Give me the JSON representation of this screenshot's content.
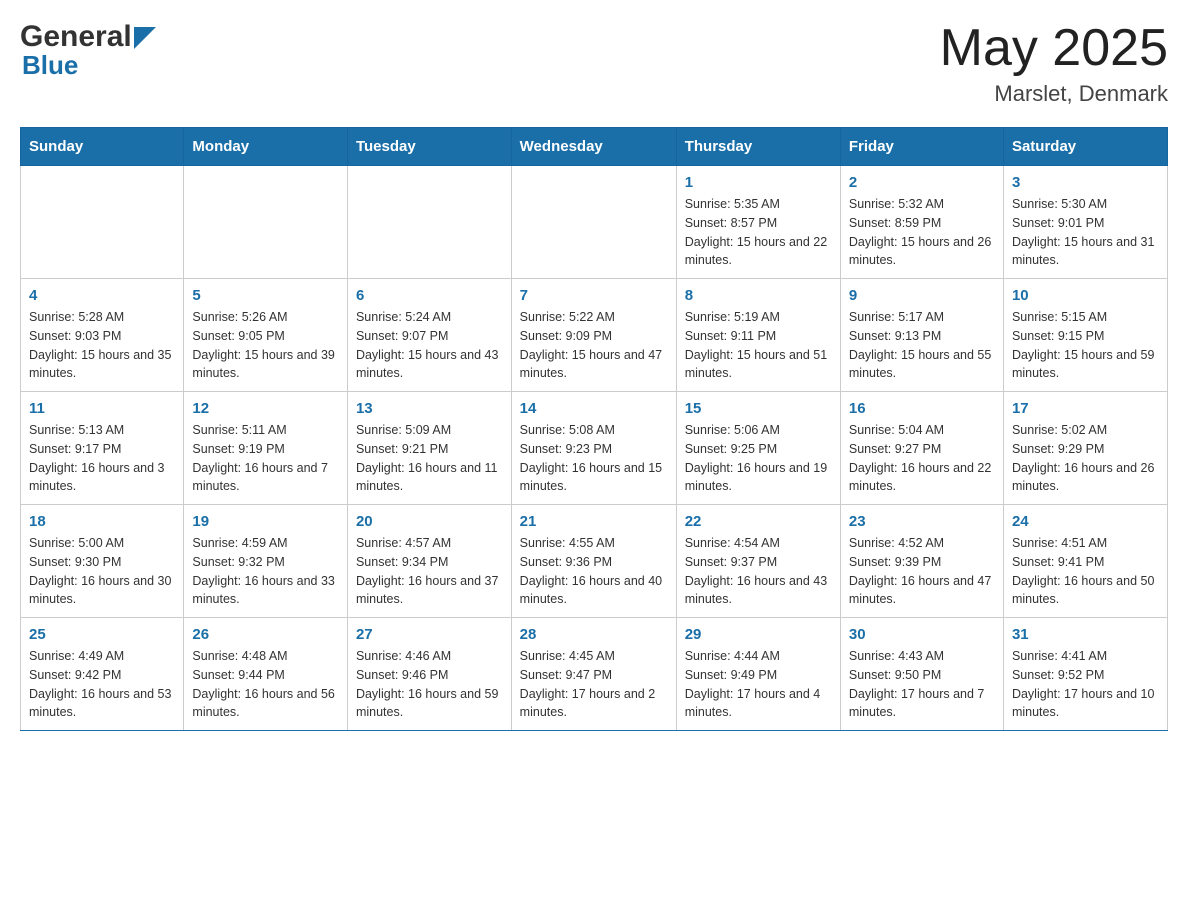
{
  "header": {
    "logo_general": "General",
    "logo_blue": "Blue",
    "month_year": "May 2025",
    "location": "Marslet, Denmark"
  },
  "weekdays": [
    "Sunday",
    "Monday",
    "Tuesday",
    "Wednesday",
    "Thursday",
    "Friday",
    "Saturday"
  ],
  "weeks": [
    [
      {
        "day": "",
        "info": ""
      },
      {
        "day": "",
        "info": ""
      },
      {
        "day": "",
        "info": ""
      },
      {
        "day": "",
        "info": ""
      },
      {
        "day": "1",
        "info": "Sunrise: 5:35 AM\nSunset: 8:57 PM\nDaylight: 15 hours and 22 minutes."
      },
      {
        "day": "2",
        "info": "Sunrise: 5:32 AM\nSunset: 8:59 PM\nDaylight: 15 hours and 26 minutes."
      },
      {
        "day": "3",
        "info": "Sunrise: 5:30 AM\nSunset: 9:01 PM\nDaylight: 15 hours and 31 minutes."
      }
    ],
    [
      {
        "day": "4",
        "info": "Sunrise: 5:28 AM\nSunset: 9:03 PM\nDaylight: 15 hours and 35 minutes."
      },
      {
        "day": "5",
        "info": "Sunrise: 5:26 AM\nSunset: 9:05 PM\nDaylight: 15 hours and 39 minutes."
      },
      {
        "day": "6",
        "info": "Sunrise: 5:24 AM\nSunset: 9:07 PM\nDaylight: 15 hours and 43 minutes."
      },
      {
        "day": "7",
        "info": "Sunrise: 5:22 AM\nSunset: 9:09 PM\nDaylight: 15 hours and 47 minutes."
      },
      {
        "day": "8",
        "info": "Sunrise: 5:19 AM\nSunset: 9:11 PM\nDaylight: 15 hours and 51 minutes."
      },
      {
        "day": "9",
        "info": "Sunrise: 5:17 AM\nSunset: 9:13 PM\nDaylight: 15 hours and 55 minutes."
      },
      {
        "day": "10",
        "info": "Sunrise: 5:15 AM\nSunset: 9:15 PM\nDaylight: 15 hours and 59 minutes."
      }
    ],
    [
      {
        "day": "11",
        "info": "Sunrise: 5:13 AM\nSunset: 9:17 PM\nDaylight: 16 hours and 3 minutes."
      },
      {
        "day": "12",
        "info": "Sunrise: 5:11 AM\nSunset: 9:19 PM\nDaylight: 16 hours and 7 minutes."
      },
      {
        "day": "13",
        "info": "Sunrise: 5:09 AM\nSunset: 9:21 PM\nDaylight: 16 hours and 11 minutes."
      },
      {
        "day": "14",
        "info": "Sunrise: 5:08 AM\nSunset: 9:23 PM\nDaylight: 16 hours and 15 minutes."
      },
      {
        "day": "15",
        "info": "Sunrise: 5:06 AM\nSunset: 9:25 PM\nDaylight: 16 hours and 19 minutes."
      },
      {
        "day": "16",
        "info": "Sunrise: 5:04 AM\nSunset: 9:27 PM\nDaylight: 16 hours and 22 minutes."
      },
      {
        "day": "17",
        "info": "Sunrise: 5:02 AM\nSunset: 9:29 PM\nDaylight: 16 hours and 26 minutes."
      }
    ],
    [
      {
        "day": "18",
        "info": "Sunrise: 5:00 AM\nSunset: 9:30 PM\nDaylight: 16 hours and 30 minutes."
      },
      {
        "day": "19",
        "info": "Sunrise: 4:59 AM\nSunset: 9:32 PM\nDaylight: 16 hours and 33 minutes."
      },
      {
        "day": "20",
        "info": "Sunrise: 4:57 AM\nSunset: 9:34 PM\nDaylight: 16 hours and 37 minutes."
      },
      {
        "day": "21",
        "info": "Sunrise: 4:55 AM\nSunset: 9:36 PM\nDaylight: 16 hours and 40 minutes."
      },
      {
        "day": "22",
        "info": "Sunrise: 4:54 AM\nSunset: 9:37 PM\nDaylight: 16 hours and 43 minutes."
      },
      {
        "day": "23",
        "info": "Sunrise: 4:52 AM\nSunset: 9:39 PM\nDaylight: 16 hours and 47 minutes."
      },
      {
        "day": "24",
        "info": "Sunrise: 4:51 AM\nSunset: 9:41 PM\nDaylight: 16 hours and 50 minutes."
      }
    ],
    [
      {
        "day": "25",
        "info": "Sunrise: 4:49 AM\nSunset: 9:42 PM\nDaylight: 16 hours and 53 minutes."
      },
      {
        "day": "26",
        "info": "Sunrise: 4:48 AM\nSunset: 9:44 PM\nDaylight: 16 hours and 56 minutes."
      },
      {
        "day": "27",
        "info": "Sunrise: 4:46 AM\nSunset: 9:46 PM\nDaylight: 16 hours and 59 minutes."
      },
      {
        "day": "28",
        "info": "Sunrise: 4:45 AM\nSunset: 9:47 PM\nDaylight: 17 hours and 2 minutes."
      },
      {
        "day": "29",
        "info": "Sunrise: 4:44 AM\nSunset: 9:49 PM\nDaylight: 17 hours and 4 minutes."
      },
      {
        "day": "30",
        "info": "Sunrise: 4:43 AM\nSunset: 9:50 PM\nDaylight: 17 hours and 7 minutes."
      },
      {
        "day": "31",
        "info": "Sunrise: 4:41 AM\nSunset: 9:52 PM\nDaylight: 17 hours and 10 minutes."
      }
    ]
  ]
}
